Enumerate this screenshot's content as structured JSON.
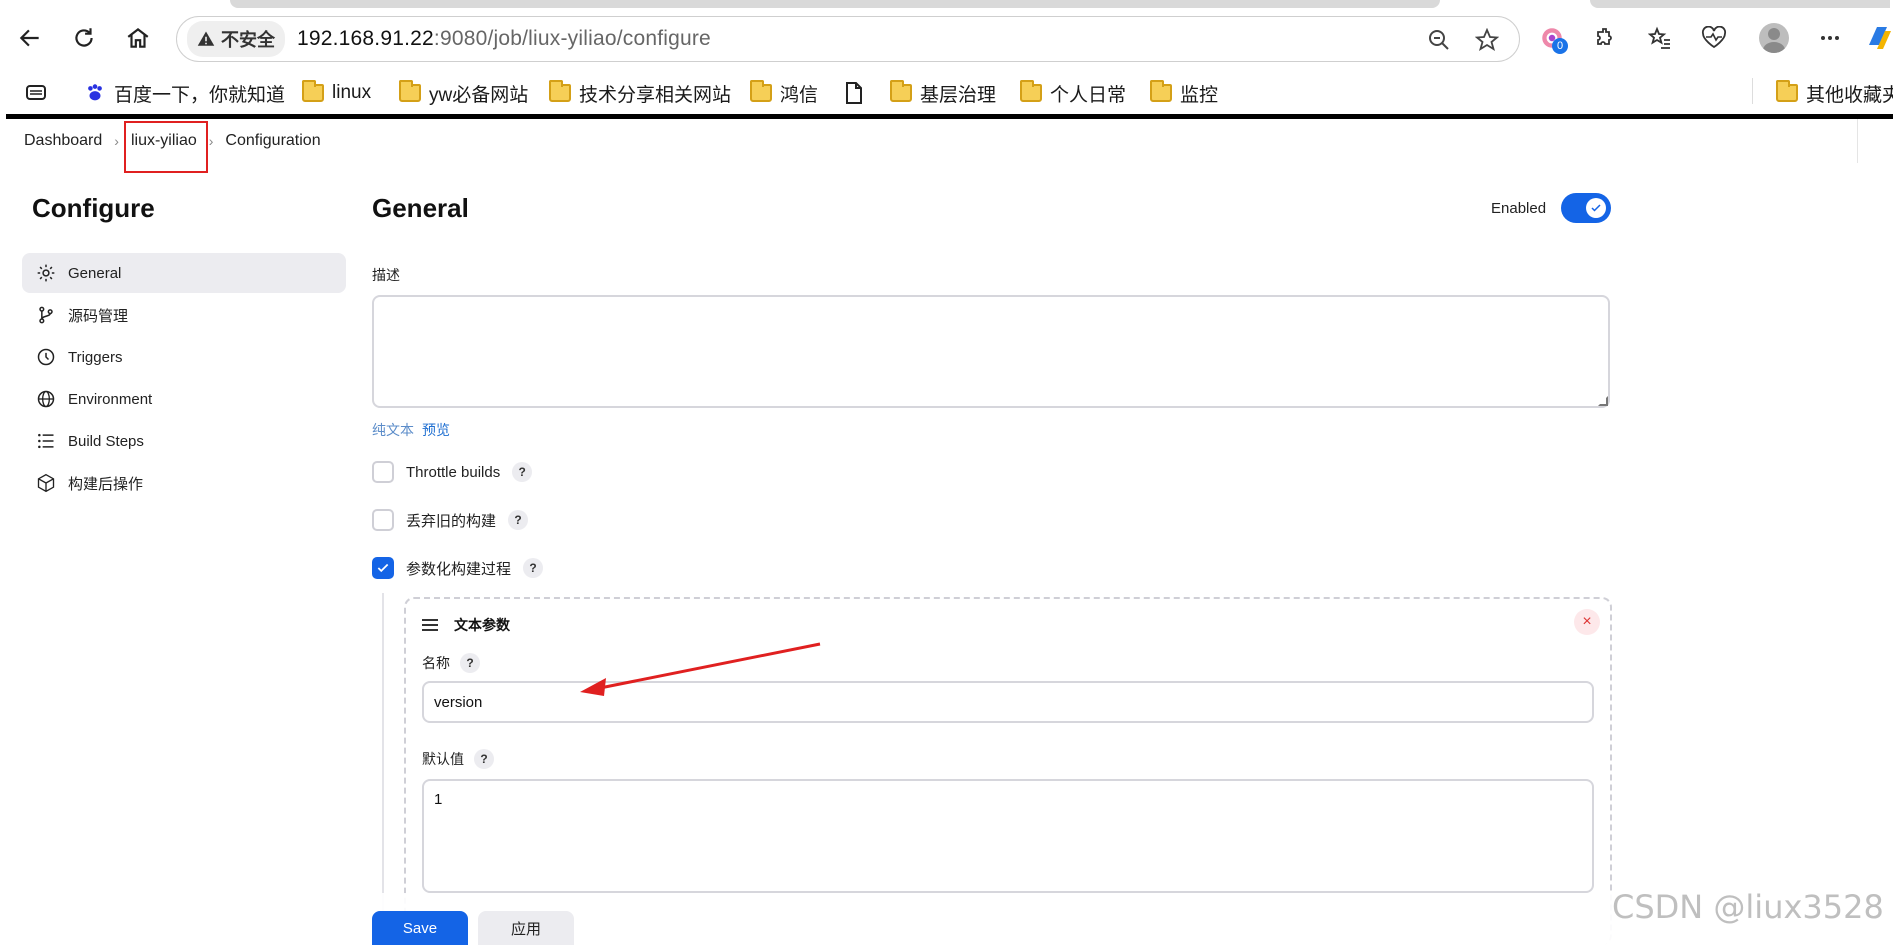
{
  "browser": {
    "insecure_label": "不安全",
    "url_host": "192.168.91.22",
    "url_rest": ":9080/job/liux-yiliao/configure",
    "extension_badge": "0"
  },
  "bookmarks": [
    {
      "label": "百度一下，你就知道",
      "icon": "baidu-paw-icon"
    },
    {
      "label": "linux",
      "icon": "folder-icon"
    },
    {
      "label": "yw必备网站",
      "icon": "folder-icon"
    },
    {
      "label": "技术分享相关网站",
      "icon": "folder-icon"
    },
    {
      "label": "鸿信",
      "icon": "folder-icon"
    },
    {
      "label": "",
      "icon": "file-icon"
    },
    {
      "label": "基层治理",
      "icon": "folder-icon"
    },
    {
      "label": "个人日常",
      "icon": "folder-icon"
    },
    {
      "label": "监控",
      "icon": "folder-icon"
    },
    {
      "label": "其他收藏夹",
      "icon": "folder-icon"
    }
  ],
  "breadcrumb": [
    "Dashboard",
    "liux-yiliao",
    "Configuration"
  ],
  "sidebar": {
    "title": "Configure",
    "items": [
      {
        "label": "General",
        "icon": "gear-icon",
        "active": true
      },
      {
        "label": "源码管理",
        "icon": "branch-icon"
      },
      {
        "label": "Triggers",
        "icon": "clock-icon"
      },
      {
        "label": "Environment",
        "icon": "globe-icon"
      },
      {
        "label": "Build Steps",
        "icon": "list-icon"
      },
      {
        "label": "构建后操作",
        "icon": "cube-icon"
      }
    ]
  },
  "general": {
    "title": "General",
    "enabled_label": "Enabled",
    "enabled": true,
    "description_label": "描述",
    "description_value": "",
    "mode_plain": "纯文本",
    "mode_preview": "预览",
    "options": [
      {
        "label": "Throttle builds",
        "checked": false
      },
      {
        "label": "丢弃旧的构建",
        "checked": false
      },
      {
        "label": "参数化构建过程",
        "checked": true
      }
    ],
    "parameter": {
      "type_label": "文本参数",
      "name_label": "名称",
      "name_value": "version",
      "default_label": "默认值",
      "default_value": "1"
    }
  },
  "actions": {
    "save": "Save",
    "apply": "应用"
  },
  "help_glyph": "?",
  "close_glyph": "×",
  "watermark": "CSDN @liux3528",
  "colors": {
    "accent": "#1464e6",
    "annotation": "#e02020"
  }
}
